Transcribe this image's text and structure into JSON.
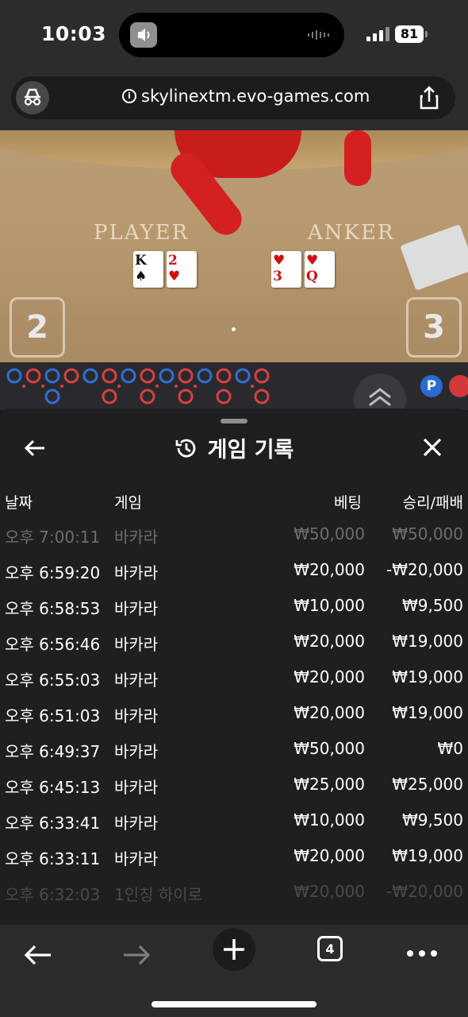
{
  "status": {
    "time": "10:03",
    "battery": "81"
  },
  "browser": {
    "url": "skylinextm.evo-games.com",
    "tab_count": "4"
  },
  "game": {
    "player_label": "PLAYER",
    "banker_label": "ANKER",
    "player_cards": [
      {
        "rank": "K",
        "suit": "♠",
        "color": "blk"
      },
      {
        "rank": "2",
        "suit": "♥",
        "color": "red"
      }
    ],
    "banker_cards": [
      {
        "rank": "3",
        "suit": "♥",
        "color": "red"
      },
      {
        "rank": "Q",
        "suit": "♥",
        "color": "red"
      }
    ],
    "player_score": "2",
    "banker_score": "3",
    "road_badge": "P"
  },
  "history": {
    "title": "게임 기록",
    "columns": {
      "date": "날짜",
      "game": "게임",
      "bet": "베팅",
      "result": "승리/패배"
    },
    "rows": [
      {
        "date": "오후 7:00:11",
        "game": "바카라",
        "bet": "₩50,000",
        "result": "₩50,000"
      },
      {
        "date": "오후 6:59:20",
        "game": "바카라",
        "bet": "₩20,000",
        "result": "-₩20,000"
      },
      {
        "date": "오후 6:58:53",
        "game": "바카라",
        "bet": "₩10,000",
        "result": "₩9,500"
      },
      {
        "date": "오후 6:56:46",
        "game": "바카라",
        "bet": "₩20,000",
        "result": "₩19,000"
      },
      {
        "date": "오후 6:55:03",
        "game": "바카라",
        "bet": "₩20,000",
        "result": "₩19,000"
      },
      {
        "date": "오후 6:51:03",
        "game": "바카라",
        "bet": "₩20,000",
        "result": "₩19,000"
      },
      {
        "date": "오후 6:49:37",
        "game": "바카라",
        "bet": "₩50,000",
        "result": "₩0"
      },
      {
        "date": "오후 6:45:13",
        "game": "바카라",
        "bet": "₩25,000",
        "result": "₩25,000"
      },
      {
        "date": "오후 6:33:41",
        "game": "바카라",
        "bet": "₩10,000",
        "result": "₩9,500"
      },
      {
        "date": "오후 6:33:11",
        "game": "바카라",
        "bet": "₩20,000",
        "result": "₩19,000"
      },
      {
        "date": "오후 6:32:03",
        "game": "1인칭 하이로",
        "bet": "₩20,000",
        "result": "-₩20,000"
      }
    ]
  },
  "icons": {
    "back": "arrow-left-icon",
    "forward": "arrow-right-icon",
    "new_tab": "plus-icon",
    "tabs": "tabs-icon",
    "more": "more-icon",
    "history": "history-icon",
    "close": "close-icon",
    "share": "share-icon",
    "incognito": "incognito-icon",
    "info": "info-icon"
  }
}
